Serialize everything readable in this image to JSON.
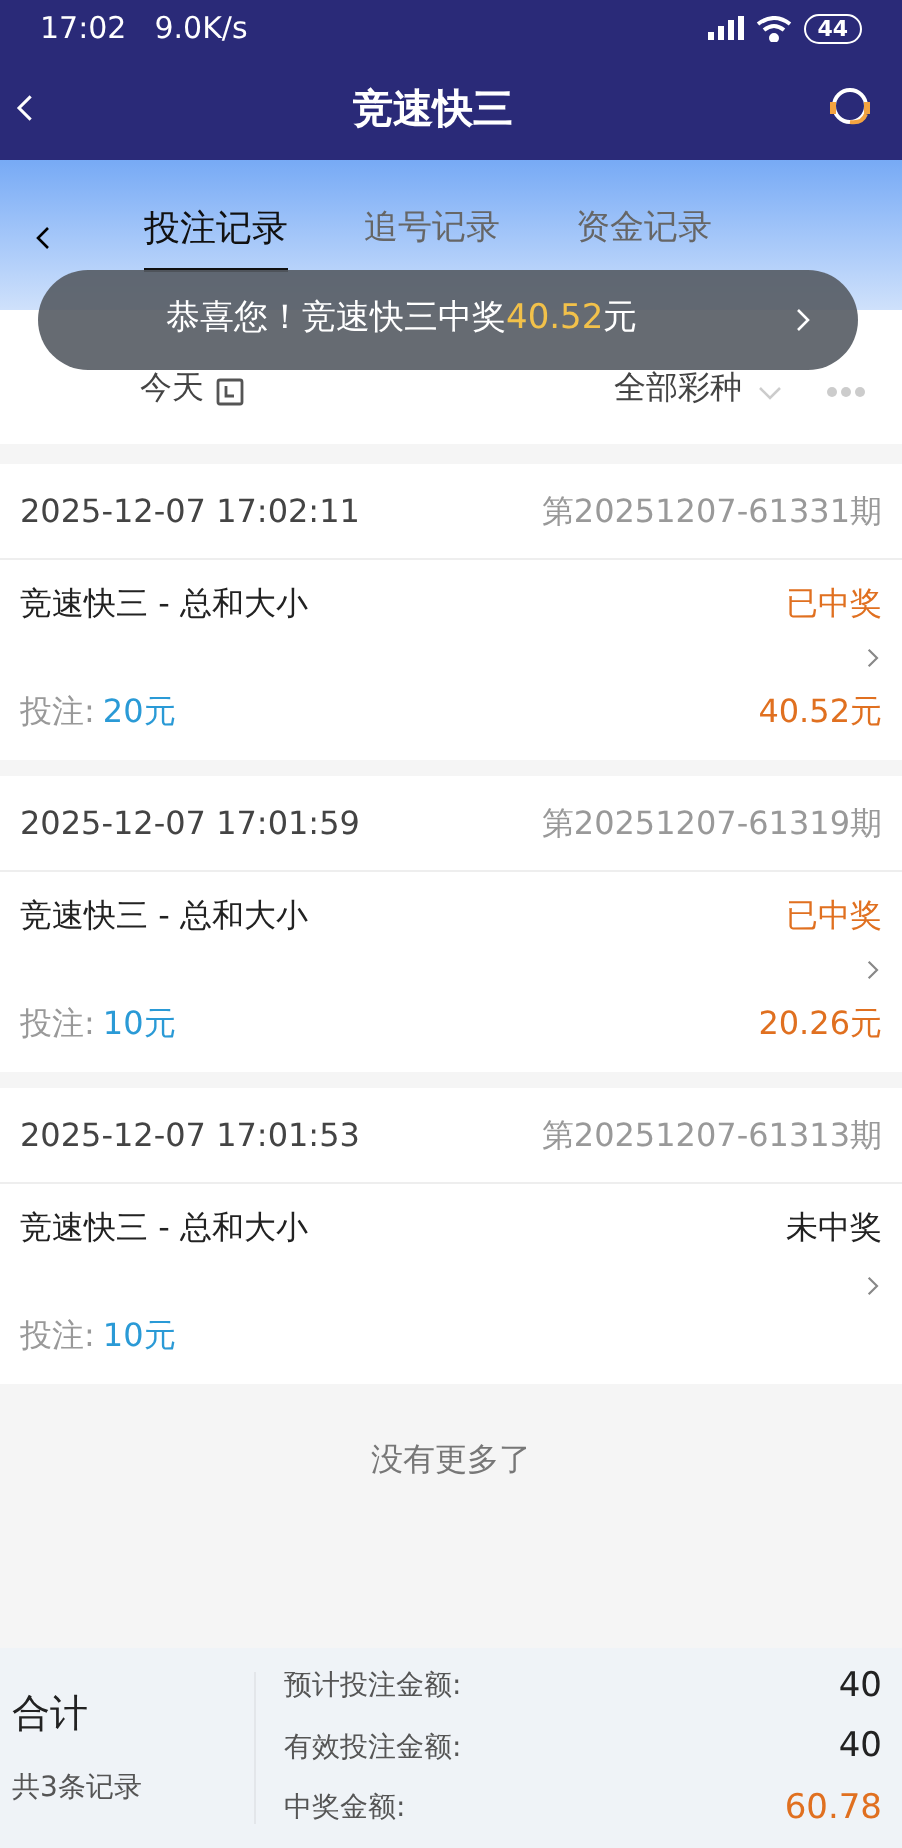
{
  "status_bar": {
    "time": "17:02",
    "speed": "9.0K/s",
    "battery": "44"
  },
  "header": {
    "title": "竞速快三"
  },
  "tabs": [
    {
      "label": "投注记录",
      "selected": true
    },
    {
      "label": "追号记录",
      "selected": false
    },
    {
      "label": "资金记录",
      "selected": false
    }
  ],
  "toast": {
    "text": "恭喜您！竞速快三中奖",
    "amount": "40.52",
    "unit": "元"
  },
  "filters": {
    "date": "今天",
    "lottery": "全部彩种"
  },
  "records": [
    {
      "time": "2025-12-07 17:02:11",
      "issue": "第20251207-61331期",
      "game": "竞速快三 - 总和大小",
      "status": "已中奖",
      "won": true,
      "bet_label": "投注:",
      "bet": "20元",
      "payout": "40.52元"
    },
    {
      "time": "2025-12-07 17:01:59",
      "issue": "第20251207-61319期",
      "game": "竞速快三 - 总和大小",
      "status": "已中奖",
      "won": true,
      "bet_label": "投注:",
      "bet": "10元",
      "payout": "20.26元"
    },
    {
      "time": "2025-12-07 17:01:53",
      "issue": "第20251207-61313期",
      "game": "竞速快三 - 总和大小",
      "status": "未中奖",
      "won": false,
      "bet_label": "投注:",
      "bet": "10元"
    }
  ],
  "end_note": "没有更多了",
  "summary": {
    "title": "合计",
    "count": "共3条记录",
    "rows": [
      {
        "label": "预计投注金额:",
        "value": "40",
        "highlight": false
      },
      {
        "label": "有效投注金额:",
        "value": "40",
        "highlight": false
      },
      {
        "label": "中奖金额:",
        "value": "60.78",
        "highlight": true
      }
    ]
  }
}
